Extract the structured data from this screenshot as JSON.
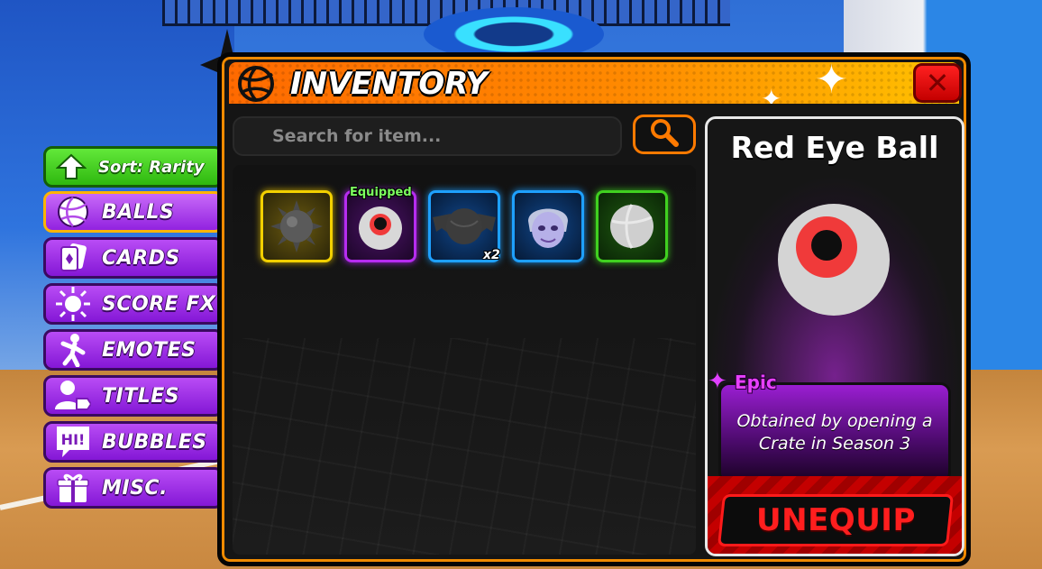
{
  "header": {
    "title": "INVENTORY",
    "close_label": "✕",
    "logo_icon": "volleyball-icon"
  },
  "search": {
    "placeholder": "Search for item...",
    "value": "",
    "button_icon": "search-icon"
  },
  "sort": {
    "label": "Sort: Rarity",
    "icon": "arrow-up-icon"
  },
  "menu": {
    "items": [
      {
        "label": "BALLS",
        "icon": "volleyball-icon",
        "active": true
      },
      {
        "label": "CARDS",
        "icon": "cards-icon",
        "active": false
      },
      {
        "label": "SCORE FX",
        "icon": "burst-icon",
        "active": false
      },
      {
        "label": "EMOTES",
        "icon": "dance-icon",
        "active": false
      },
      {
        "label": "TITLES",
        "icon": "user-tag-icon",
        "active": false
      },
      {
        "label": "BUBBLES",
        "icon": "chat-bubble-icon",
        "active": false
      },
      {
        "label": "MISC.",
        "icon": "gift-icon",
        "active": false
      }
    ]
  },
  "inventory": {
    "items": [
      {
        "name": "spiked-ball",
        "rarity_color": "#f2d000"
      },
      {
        "name": "red-eye-ball",
        "rarity_color": "#b62cf0",
        "equipped_label": "Equipped"
      },
      {
        "name": "bat-wing-ball",
        "rarity_color": "#1ea0ff",
        "quantity_label": "x2"
      },
      {
        "name": "ghost-face-ball",
        "rarity_color": "#1ea0ff"
      },
      {
        "name": "white-ball",
        "rarity_color": "#40d020"
      }
    ]
  },
  "detail": {
    "title": "Red Eye Ball",
    "rarity": "Epic",
    "rarity_color": "#e840ff",
    "description": "Obtained by opening a Crate in Season 3",
    "action_label": "UNEQUIP"
  }
}
